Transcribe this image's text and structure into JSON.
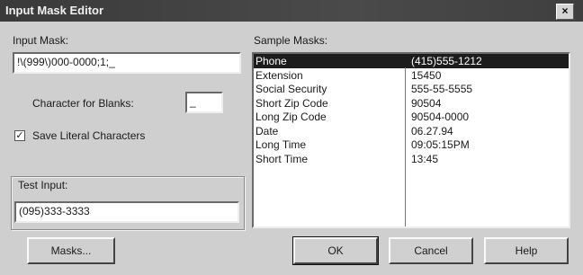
{
  "window": {
    "title": "Input Mask Editor",
    "close_glyph": "×"
  },
  "input_mask": {
    "label": "Input Mask:",
    "value": "!\\(999\\)000-0000;1;_"
  },
  "blanks": {
    "label": "Character for Blanks:",
    "value": "_"
  },
  "literal": {
    "label": "Save Literal Characters",
    "checked": true
  },
  "test_input": {
    "label": "Test Input:",
    "value": "(095)333-3333"
  },
  "sample_masks": {
    "label": "Sample Masks:",
    "items": [
      {
        "name": "Phone",
        "sample": "(415)555-1212",
        "selected": true
      },
      {
        "name": "Extension",
        "sample": "15450"
      },
      {
        "name": "Social Security",
        "sample": "555-55-5555"
      },
      {
        "name": "Short Zip Code",
        "sample": "90504"
      },
      {
        "name": "Long Zip Code",
        "sample": "90504-0000"
      },
      {
        "name": "Date",
        "sample": "06.27.94"
      },
      {
        "name": "Long Time",
        "sample": "09:05:15PM"
      },
      {
        "name": "Short Time",
        "sample": "13:45"
      }
    ]
  },
  "buttons": {
    "masks": "Masks...",
    "ok": "OK",
    "cancel": "Cancel",
    "help": "Help"
  }
}
